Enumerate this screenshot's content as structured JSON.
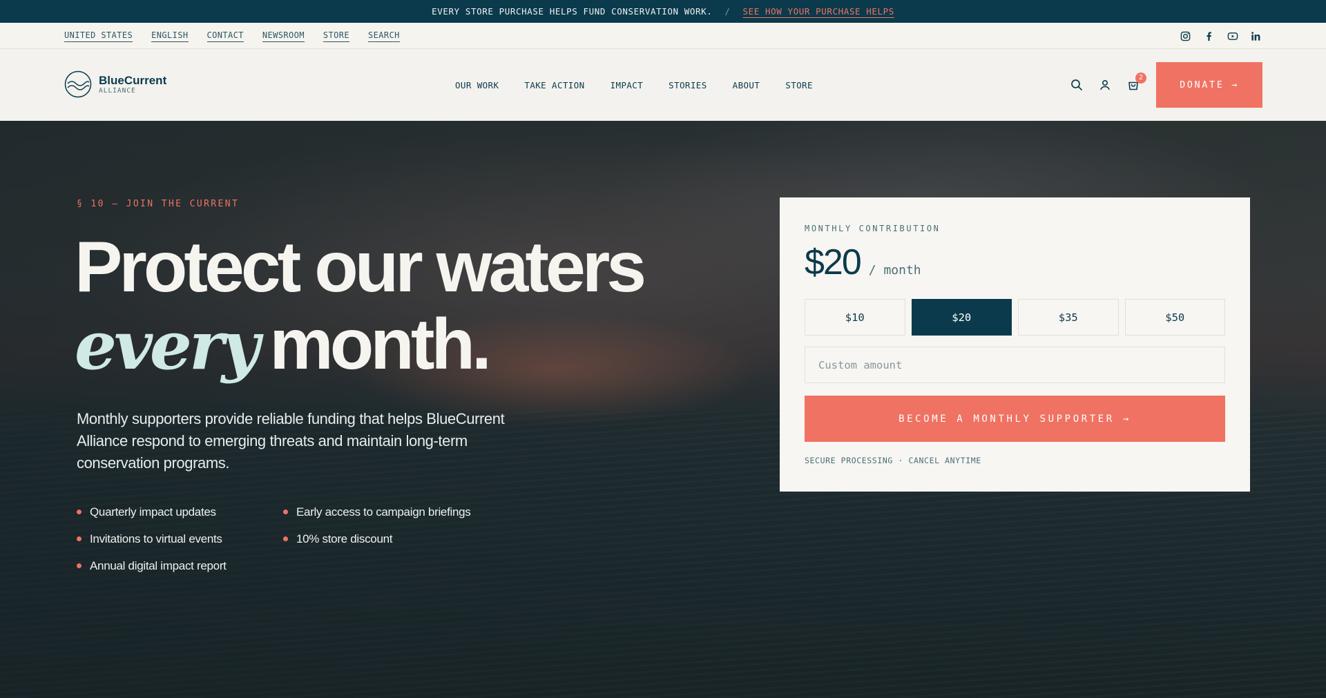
{
  "announcement": {
    "text": "EVERY STORE PURCHASE HELPS FUND CONSERVATION WORK.",
    "separator": "/",
    "link": "SEE HOW YOUR PURCHASE HELPS"
  },
  "utility": {
    "links": [
      "UNITED STATES",
      "ENGLISH",
      "CONTACT",
      "NEWSROOM",
      "STORE",
      "SEARCH"
    ],
    "social": [
      "instagram-icon",
      "facebook-icon",
      "youtube-icon",
      "linkedin-icon"
    ]
  },
  "brand": {
    "name": "BlueCurrent",
    "sub": "ALLIANCE"
  },
  "nav": {
    "items": [
      "OUR WORK",
      "TAKE ACTION",
      "IMPACT",
      "STORIES",
      "ABOUT",
      "STORE"
    ],
    "cart_count": "2",
    "donate": "DONATE →"
  },
  "hero": {
    "eyebrow": "§ 10 — JOIN THE CURRENT",
    "headline_line1": "Protect our waters",
    "headline_em": "every",
    "headline_rest": "month.",
    "lead": "Monthly supporters provide reliable funding that helps BlueCurrent Alliance respond to emerging threats and maintain long-term conservation programs.",
    "benefits": [
      "Quarterly impact updates",
      "Early access to campaign briefings",
      "Invitations to virtual events",
      "10% store discount",
      "Annual digital impact report"
    ]
  },
  "donation": {
    "label": "MONTHLY CONTRIBUTION",
    "amount": "$20",
    "period": "/ month",
    "options": [
      "$10",
      "$20",
      "$35",
      "$50"
    ],
    "selected": "$20",
    "custom_placeholder": "Custom amount",
    "cta": "BECOME A MONTHLY SUPPORTER →",
    "note": "SECURE PROCESSING · CANCEL ANYTIME"
  },
  "colors": {
    "brand_dark": "#0b3a4c",
    "accent": "#f07263",
    "background_light": "#f3f2ee",
    "highlight_text": "#cfe9e4"
  }
}
